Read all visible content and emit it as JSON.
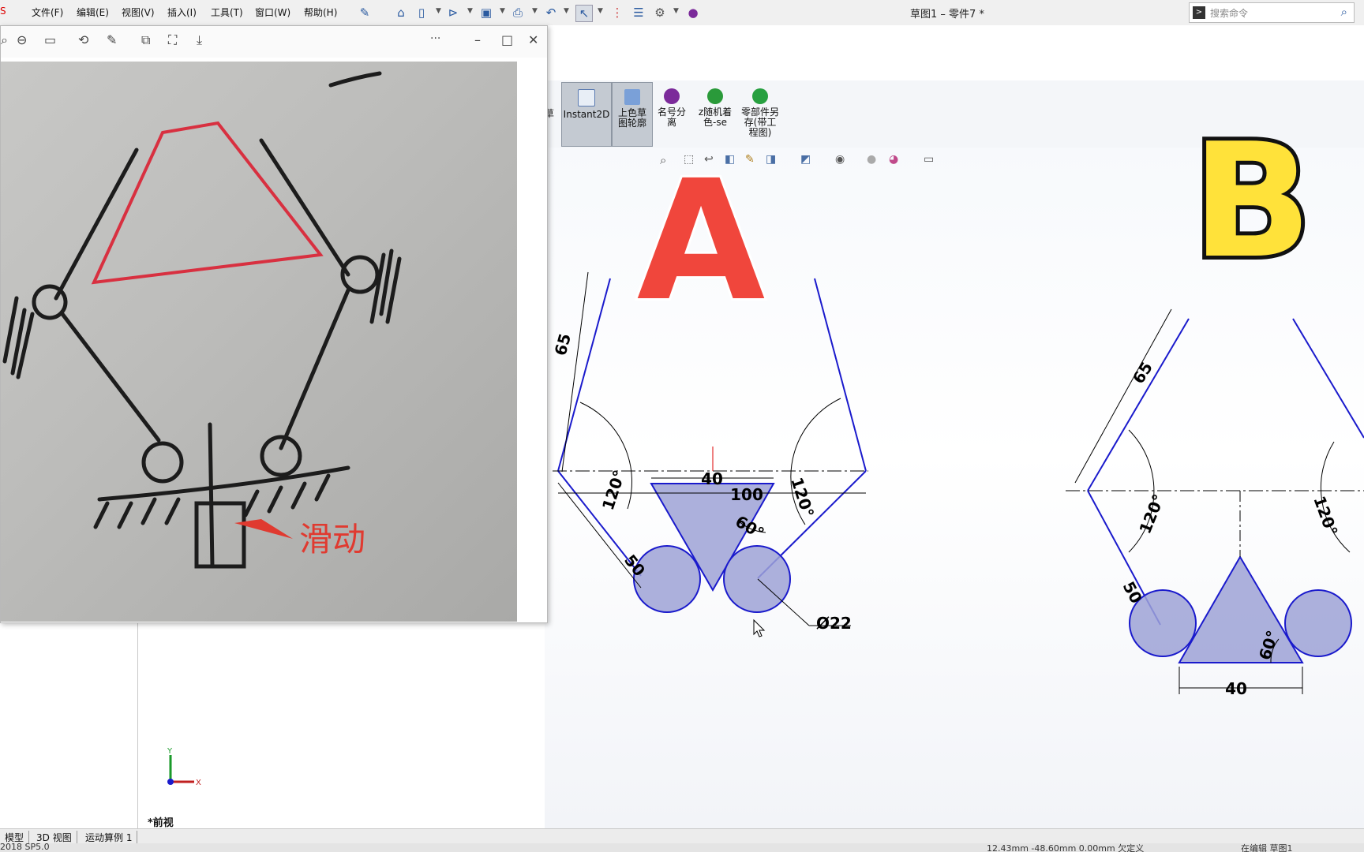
{
  "menubar": {
    "items": [
      "文件(F)",
      "编辑(E)",
      "视图(V)",
      "插入(I)",
      "工具(T)",
      "窗口(W)",
      "帮助(H)"
    ],
    "document_title": "草图1 – 零件7 *",
    "search_placeholder": "搜索命令"
  },
  "command_manager": {
    "partial_label": "草",
    "buttons": [
      {
        "label": "Instant2D",
        "icon": "instant2d-icon"
      },
      {
        "label": "上色草图轮廓",
        "icon": "shaded-sketch-icon"
      },
      {
        "label": "名号分离",
        "icon": "purple-ball-icon"
      },
      {
        "label": "z随机着色-se",
        "icon": "green-ball-icon"
      },
      {
        "label": "零部件另存(带工程图)",
        "icon": "green-save-icon"
      }
    ]
  },
  "viewer": {
    "toolbar_more": "···",
    "window_controls": [
      "–",
      "□",
      "✕"
    ],
    "photo_annotation": "滑动"
  },
  "sketch_a": {
    "overlay_letter": "A",
    "dims": [
      "65",
      "120°",
      "50",
      "40",
      "100",
      "60°",
      "120°",
      "Ø22"
    ]
  },
  "sketch_b": {
    "overlay_letter": "B",
    "dims": [
      "65",
      "120°",
      "50",
      "120°",
      "60°",
      "40"
    ]
  },
  "triad": {
    "y": "Y",
    "x": "X"
  },
  "view_label": "*前视",
  "bottom_tabs": [
    "模型",
    "3D 视图",
    "运动算例 1"
  ],
  "status": {
    "left": "2018 SP5.0",
    "mid": "12.43mm   -48.60mm  0.00mm   欠定义",
    "right": "在编辑 草图1"
  },
  "colors": {
    "sketch_blue": "#1a1acc",
    "fill_blue": "#9ea2d6",
    "letter_a": "#f0463c",
    "letter_b": "#ffe23a"
  }
}
